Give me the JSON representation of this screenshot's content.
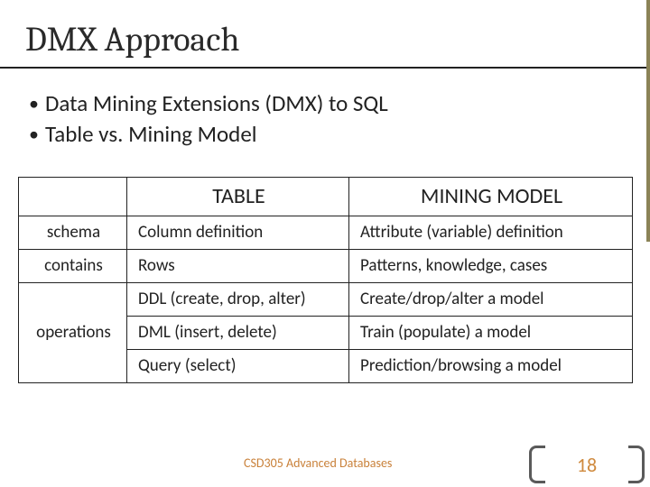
{
  "title": "DMX Approach",
  "bullets": [
    "Data Mining Extensions (DMX) to SQL",
    "Table vs. Mining Model"
  ],
  "table": {
    "headers": [
      "TABLE",
      "MINING MODEL"
    ],
    "rows": [
      {
        "label": "schema",
        "table": "Column definition",
        "model": "Attribute (variable) definition"
      },
      {
        "label": "contains",
        "table": "Rows",
        "model": "Patterns, knowledge, cases"
      },
      {
        "label": "operations",
        "items": [
          {
            "table": "DDL (create, drop, alter)",
            "model": "Create/drop/alter a model"
          },
          {
            "table": "DML (insert, delete)",
            "model": "Train (populate) a model"
          },
          {
            "table": "Query (select)",
            "model": "Prediction/browsing a model"
          }
        ]
      }
    ]
  },
  "footer": {
    "text": "CSD305 Advanced Databases",
    "page": "18"
  }
}
